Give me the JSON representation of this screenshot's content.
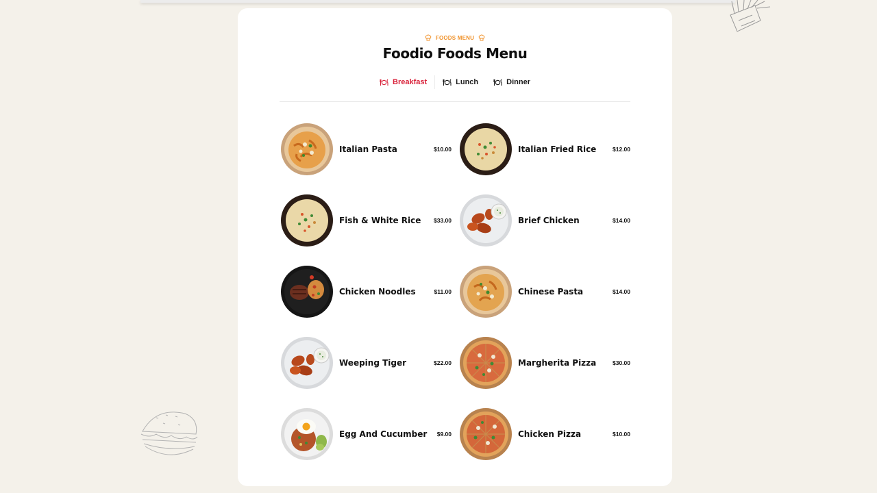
{
  "section": {
    "eyebrow": "FOODS MENU",
    "title": "Foodio Foods Menu"
  },
  "tabs": [
    {
      "label": "Breakfast",
      "active": true,
      "icon": "utensils-plate-icon"
    },
    {
      "label": "Lunch",
      "active": false,
      "icon": "utensils-plate-icon"
    },
    {
      "label": "Dinner",
      "active": false,
      "icon": "utensils-plate-icon"
    }
  ],
  "menu": [
    {
      "name": "Italian Pasta",
      "price": "$10.00",
      "photo": "pasta-plate"
    },
    {
      "name": "Italian Fried Rice",
      "price": "$12.00",
      "photo": "fried-rice-bowl"
    },
    {
      "name": "Fish & White Rice",
      "price": "$33.00",
      "photo": "fried-rice-bowl"
    },
    {
      "name": "Brief Chicken",
      "price": "$14.00",
      "photo": "chicken-wings-plate"
    },
    {
      "name": "Chicken Noodles",
      "price": "$11.00",
      "photo": "steak-pasta-plate"
    },
    {
      "name": "Chinese Pasta",
      "price": "$14.00",
      "photo": "pasta-plate"
    },
    {
      "name": "Weeping Tiger",
      "price": "$22.00",
      "photo": "chicken-wings-plate"
    },
    {
      "name": "Margherita Pizza",
      "price": "$30.00",
      "photo": "pizza"
    },
    {
      "name": "Egg And Cucumber",
      "price": "$9.00",
      "photo": "egg-rice-plate"
    },
    {
      "name": "Chicken Pizza",
      "price": "$10.00",
      "photo": "pizza"
    }
  ],
  "colors": {
    "page_background": "#f4f1ea",
    "card": "#ffffff",
    "accent_orange": "#f0922b",
    "active_tab_red": "#d9233b"
  },
  "decorations": [
    "french-fries-doodle-icon",
    "burger-doodle-icon"
  ]
}
